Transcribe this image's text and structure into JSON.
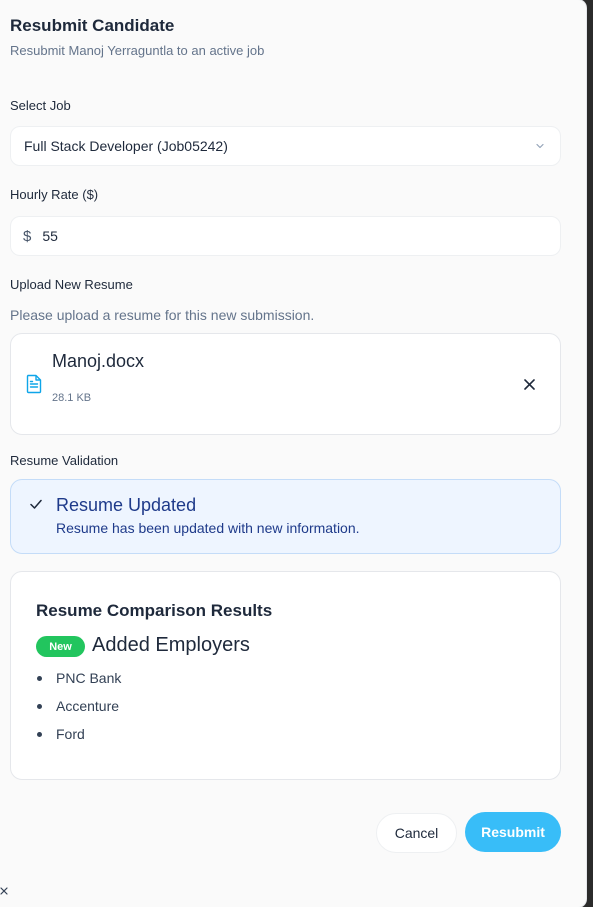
{
  "dialog": {
    "title": "Resubmit Candidate",
    "subtitle": "Resubmit Manoj Yerraguntla to an active job"
  },
  "job_select": {
    "label": "Select Job",
    "value": "Full Stack Developer (Job05242)",
    "icon": "chevron-down-icon"
  },
  "hourly_rate": {
    "label": "Hourly Rate ($)",
    "prefix": "$",
    "value": "55"
  },
  "upload": {
    "label": "Upload New Resume",
    "hint": "Please upload a resume for this new submission.",
    "file_name": "Manoj.docx",
    "file_size": "28.1 KB",
    "icon": "document-icon",
    "remove_icon": "close-icon"
  },
  "validation": {
    "label": "Resume Validation",
    "title": "Resume Updated",
    "description": "Resume has been updated with new information.",
    "icon": "check-icon"
  },
  "comparison": {
    "title": "Resume Comparison Results",
    "badge": "New",
    "section_heading": "Added Employers",
    "employers": [
      "PNC Bank",
      "Accenture",
      "Ford"
    ]
  },
  "actions": {
    "cancel_label": "Cancel",
    "submit_label": "Resubmit"
  },
  "colors": {
    "accent": "#38bdf8",
    "badge_green": "#22c55e",
    "info_bg": "#eef5ff",
    "info_text": "#1e3a8a",
    "file_icon": "#0ea5e9"
  }
}
